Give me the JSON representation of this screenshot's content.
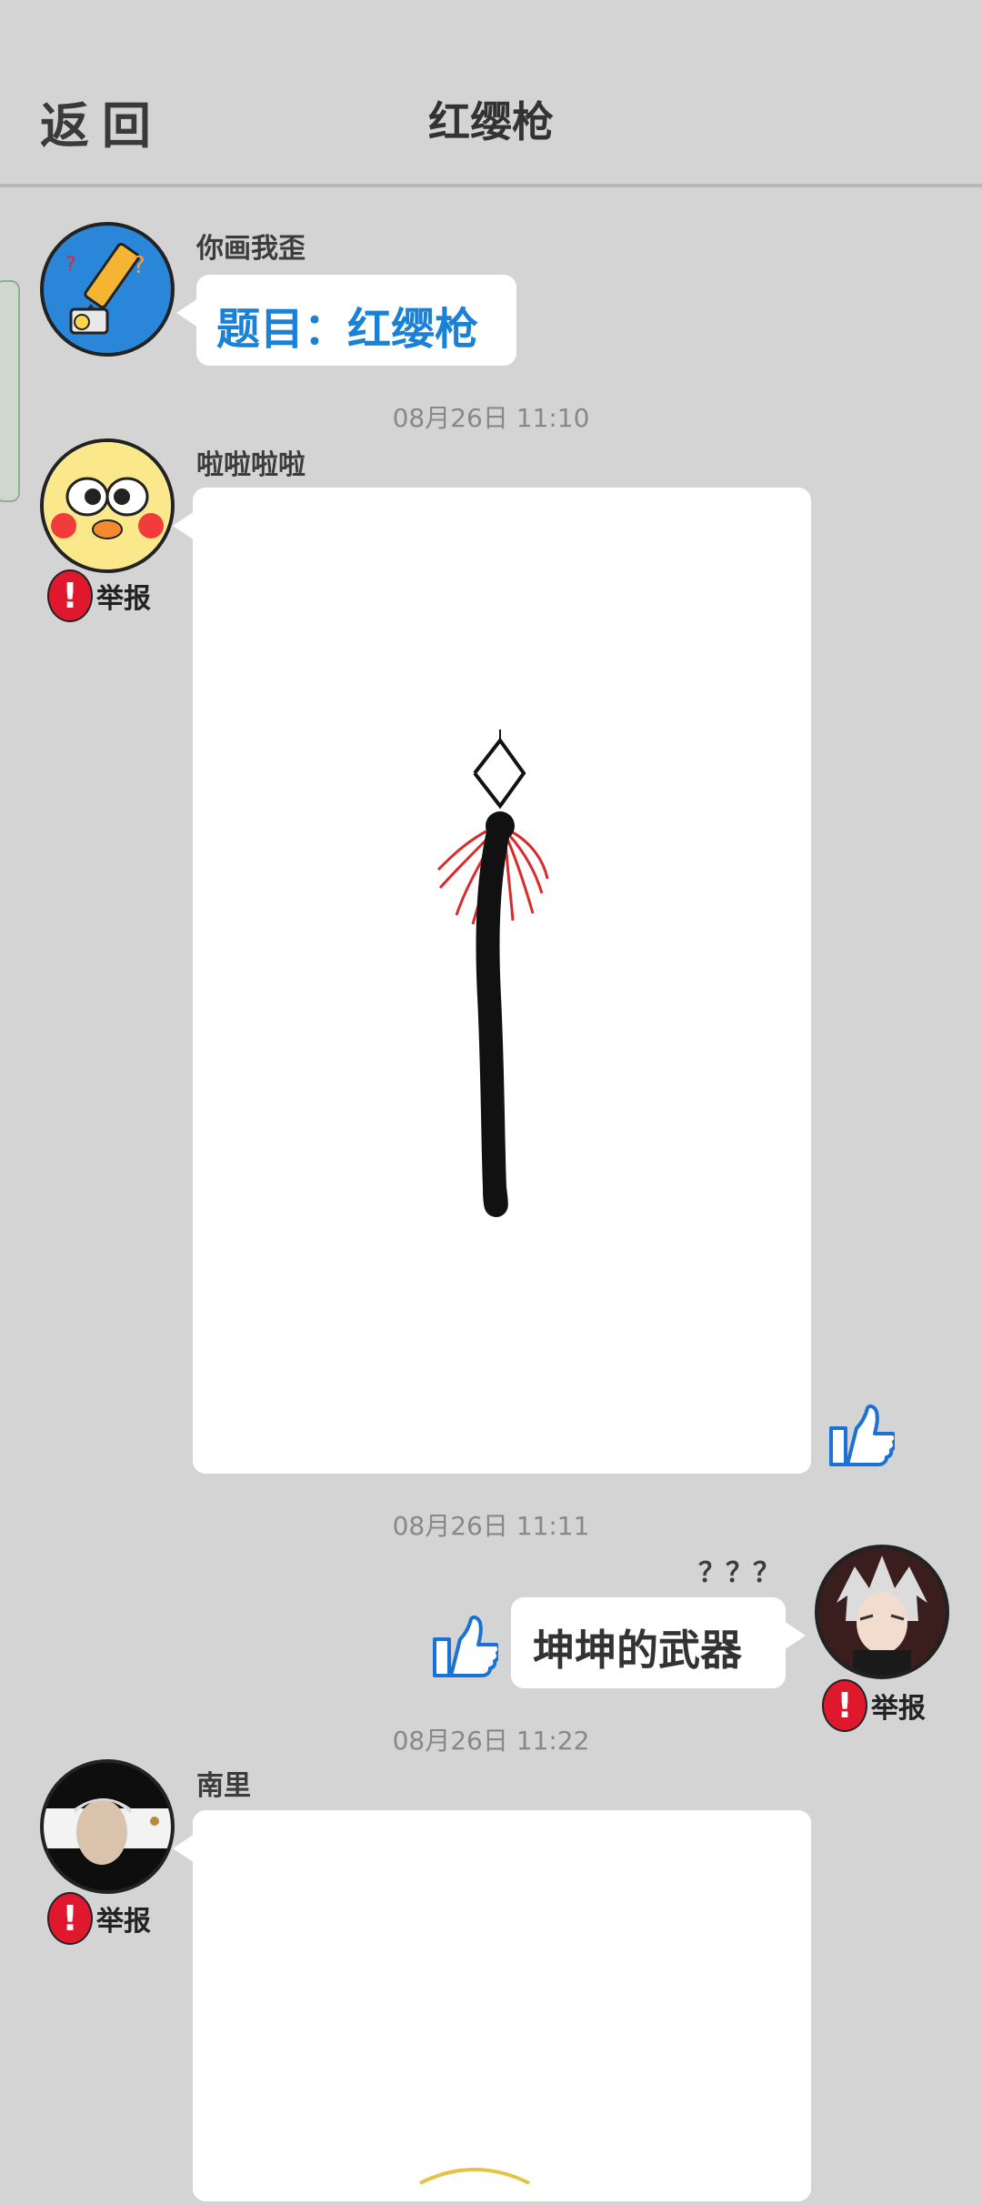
{
  "header": {
    "back_label": "返回",
    "title": "红缨枪"
  },
  "messages": [
    {
      "sender": "你画我歪",
      "text": "题目：红缨枪"
    },
    {
      "time": "08月26日  11:10",
      "sender": "啦啦啦啦",
      "report_label": "举报"
    },
    {
      "time": "08月26日  11:11",
      "sender": "？？？",
      "text": "坤坤的武器",
      "report_label": "举报"
    },
    {
      "time": "08月26日  11:22",
      "sender": "南里",
      "report_label": "举报"
    }
  ],
  "colors": {
    "accent_blue": "#1a82d6",
    "report_red": "#e0182d",
    "tassel_red": "#d92b2b"
  }
}
